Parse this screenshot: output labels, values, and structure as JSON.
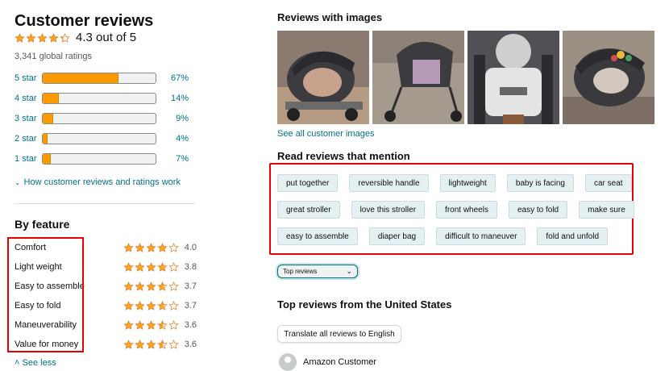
{
  "summary": {
    "title": "Customer reviews",
    "rating_text": "4.3 out of 5",
    "rating_value": 4.3,
    "global_ratings": "3,341 global ratings",
    "histogram": [
      {
        "label": "5 star",
        "percent_text": "67%",
        "percent": 67
      },
      {
        "label": "4 star",
        "percent_text": "14%",
        "percent": 14
      },
      {
        "label": "3 star",
        "percent_text": "9%",
        "percent": 9
      },
      {
        "label": "2 star",
        "percent_text": "4%",
        "percent": 4
      },
      {
        "label": "1 star",
        "percent_text": "7%",
        "percent": 7
      }
    ],
    "how_link": "How customer reviews and ratings work"
  },
  "by_feature": {
    "title": "By feature",
    "items": [
      {
        "name": "Comfort",
        "rating_text": "4.0",
        "rating": 4.0
      },
      {
        "name": "Light weight",
        "rating_text": "3.8",
        "rating": 3.8
      },
      {
        "name": "Easy to assemble",
        "rating_text": "3.7",
        "rating": 3.7
      },
      {
        "name": "Easy to fold",
        "rating_text": "3.7",
        "rating": 3.7
      },
      {
        "name": "Maneuverability",
        "rating_text": "3.6",
        "rating": 3.6
      },
      {
        "name": "Value for money",
        "rating_text": "3.6",
        "rating": 3.6
      }
    ],
    "see_less": "See less"
  },
  "images": {
    "title": "Reviews with images",
    "see_all": "See all customer images"
  },
  "mentions": {
    "title": "Read reviews that mention",
    "rows": [
      [
        "put together",
        "reversible handle",
        "lightweight",
        "baby is facing",
        "car seat"
      ],
      [
        "great stroller",
        "love this stroller",
        "front wheels",
        "easy to fold",
        "make sure"
      ],
      [
        "easy to assemble",
        "diaper bag",
        "difficult to maneuver",
        "fold and unfold"
      ]
    ]
  },
  "sort": {
    "selected": "Top reviews"
  },
  "top_reviews": {
    "title": "Top reviews from the United States",
    "translate_button": "Translate all reviews to English",
    "first_reviewer": "Amazon Customer"
  },
  "colors": {
    "star": "#ffa41c",
    "bar_fill": "#ff9900",
    "link": "#007185",
    "highlight_box": "#e60000",
    "chip_bg": "#e4f0f1"
  }
}
